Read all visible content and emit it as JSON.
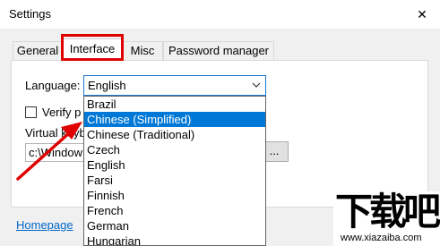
{
  "window": {
    "title": "Settings",
    "close_glyph": "✕"
  },
  "tabs": [
    {
      "label": "General",
      "active": false
    },
    {
      "label": "Interface",
      "active": true
    },
    {
      "label": "Misc",
      "active": false
    },
    {
      "label": "Password manager",
      "active": false
    }
  ],
  "interface": {
    "language_label": "Language:",
    "language_value": "English",
    "checkbox_label": "Verify p",
    "virtual_label": "Virtual keyb",
    "virtual_path": "c:\\Window",
    "browse_label": "..."
  },
  "dropdown": {
    "options": [
      "Brazil",
      "Chinese (Simplified)",
      "Chinese (Traditional)",
      "Czech",
      "English",
      "Farsi",
      "Finnish",
      "French",
      "German",
      "Hungarian"
    ],
    "selected": "Chinese (Simplified)"
  },
  "footer": {
    "homepage_link": "Homepage"
  },
  "watermark": {
    "logo": "下载吧",
    "url": "www.xiazaiba.com"
  },
  "colors": {
    "highlight": "#e00000",
    "selection": "#0078d7",
    "link": "#0066cc",
    "focus_border": "#1e78d4"
  }
}
